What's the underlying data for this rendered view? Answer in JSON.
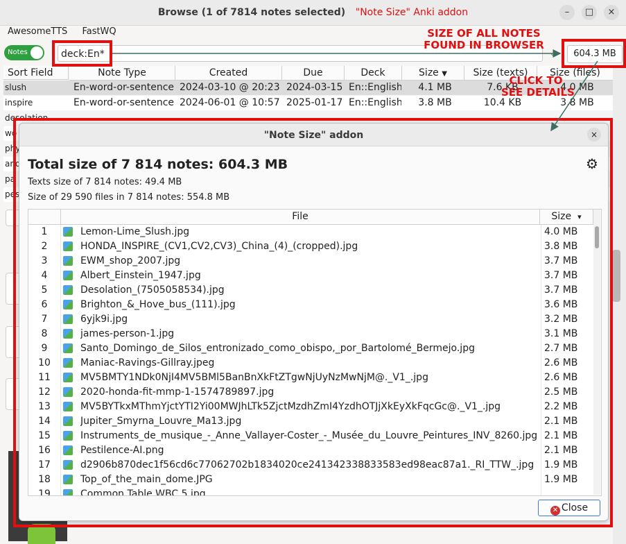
{
  "window": {
    "title_main": "Browse (1 of 7814 notes selected)",
    "title_annotation": "\"Note Size\" Anki addon",
    "btn_minimize": "–",
    "btn_maximize": "□",
    "btn_close": "×"
  },
  "menu": [
    "AwesomeTTS",
    "FastWQ"
  ],
  "search": {
    "toggle_label": "Notes",
    "query": "deck:En*",
    "dropdown": "⌵",
    "total_button": "604.3 MB"
  },
  "annotations": {
    "size_all": "SIZE OF ALL NOTES\nFOUND IN BROWSER",
    "click": "CLICK TO\nSEE DETAILS"
  },
  "browser_table": {
    "columns": [
      "Sort Field",
      "Note Type",
      "Created",
      "Due",
      "Deck",
      "Size",
      "Size (texts)",
      "Size (files)"
    ],
    "rows": [
      [
        "slush",
        "En-word-or-sentence",
        "2024-03-10 @ 20:23",
        "2024-03-15",
        "En::English",
        "4.1 MB",
        "7.6 KB",
        "4.0 MB"
      ],
      [
        "inspire",
        "En-word-or-sentence",
        "2024-06-01 @ 10:57",
        "2025-01-17",
        "En::English",
        "3.8 MB",
        "10.4 KB",
        "3.8 MB"
      ],
      [
        "desolation",
        "",
        "",
        "",
        "",
        "",
        "",
        ""
      ],
      [
        "wo",
        "",
        "",
        "",
        "",
        "",
        "",
        ""
      ],
      [
        "phy",
        "",
        "",
        "",
        "",
        "",
        "",
        ""
      ],
      [
        "and",
        "",
        "",
        "",
        "",
        "",
        "",
        ""
      ],
      [
        "pa",
        "",
        "",
        "",
        "",
        "",
        "",
        ""
      ],
      [
        "pes",
        "",
        "",
        "",
        "",
        "",
        "",
        ""
      ]
    ]
  },
  "dialog": {
    "title": "\"Note Size\" addon",
    "close_x": "×",
    "total_size": "Total size of 7 814 notes: 604.3 MB",
    "texts_size": "Texts size of 7 814 notes: 49.4 MB",
    "files_size": "Size of 29 590 files in 7 814 notes: 554.8 MB",
    "gear": "⚙",
    "table": {
      "columns": [
        "File",
        "Size"
      ],
      "sort_arrow": "▾",
      "rows": [
        {
          "num": "1",
          "file": "Lemon-Lime_Slush.jpg",
          "size": "4.0 MB"
        },
        {
          "num": "2",
          "file": "HONDA_INSPIRE_(CV1,CV2,CV3)_China_(4)_(cropped).jpg",
          "size": "3.8 MB"
        },
        {
          "num": "3",
          "file": "EWM_shop_2007.jpg",
          "size": "3.7 MB"
        },
        {
          "num": "4",
          "file": "Albert_Einstein_1947.jpg",
          "size": "3.7 MB"
        },
        {
          "num": "5",
          "file": "Desolation_(7505058534).jpg",
          "size": "3.7 MB"
        },
        {
          "num": "6",
          "file": "Brighton_&_Hove_bus_(111).jpg",
          "size": "3.6 MB"
        },
        {
          "num": "7",
          "file": "6yjk9i.jpg",
          "size": "3.2 MB"
        },
        {
          "num": "8",
          "file": "james-person-1.jpg",
          "size": "3.1 MB"
        },
        {
          "num": "9",
          "file": "Santo_Domingo_de_Silos_entronizado_como_obispo,_por_Bartolomé_Bermejo.jpg",
          "size": "2.7 MB"
        },
        {
          "num": "10",
          "file": "Maniac-Ravings-Gillray.jpeg",
          "size": "2.6 MB"
        },
        {
          "num": "11",
          "file": "MV5BMTY1NDk0NjI4MV5BMl5BanBnXkFtZTgwNjUyNzMwNjM@._V1_.jpg",
          "size": "2.6 MB"
        },
        {
          "num": "12",
          "file": "2020-honda-fit-mmp-1-1574789897.jpg",
          "size": "2.5 MB"
        },
        {
          "num": "13",
          "file": "MV5BYTkxMThmYjctYTI2Yi00MWJhLTk5ZjctMzdhZmI4YzdhOTJjXkEyXkFqcGc@._V1_.jpg",
          "size": "2.2 MB"
        },
        {
          "num": "14",
          "file": "Jupiter_Smyrna_Louvre_Ma13.jpg",
          "size": "2.1 MB"
        },
        {
          "num": "15",
          "file": "Instruments_de_musique_-_Anne_Vallayer-Coster_-_Musée_du_Louvre_Peintures_INV_8260.jpg",
          "size": "2.1 MB"
        },
        {
          "num": "16",
          "file": "Pestilence-AI.png",
          "size": "2.1 MB"
        },
        {
          "num": "17",
          "file": "d2906b870dec1f56cd6c77062702b1834020ce241342338833583ed98eac87a1._RI_TTW_.jpg",
          "size": "1.9 MB"
        },
        {
          "num": "18",
          "file": "Top_of_the_main_dome.JPG",
          "size": "1.9 MB"
        },
        {
          "num": "19",
          "file": "Common Table WBC 5.jpg",
          "size": ""
        }
      ]
    },
    "close_label": "Close",
    "close_icon": "✕"
  },
  "colors": {
    "annotation_red": "#e01010",
    "toggle_green": "#2ea040",
    "selected_row": "#dcdcdc"
  }
}
